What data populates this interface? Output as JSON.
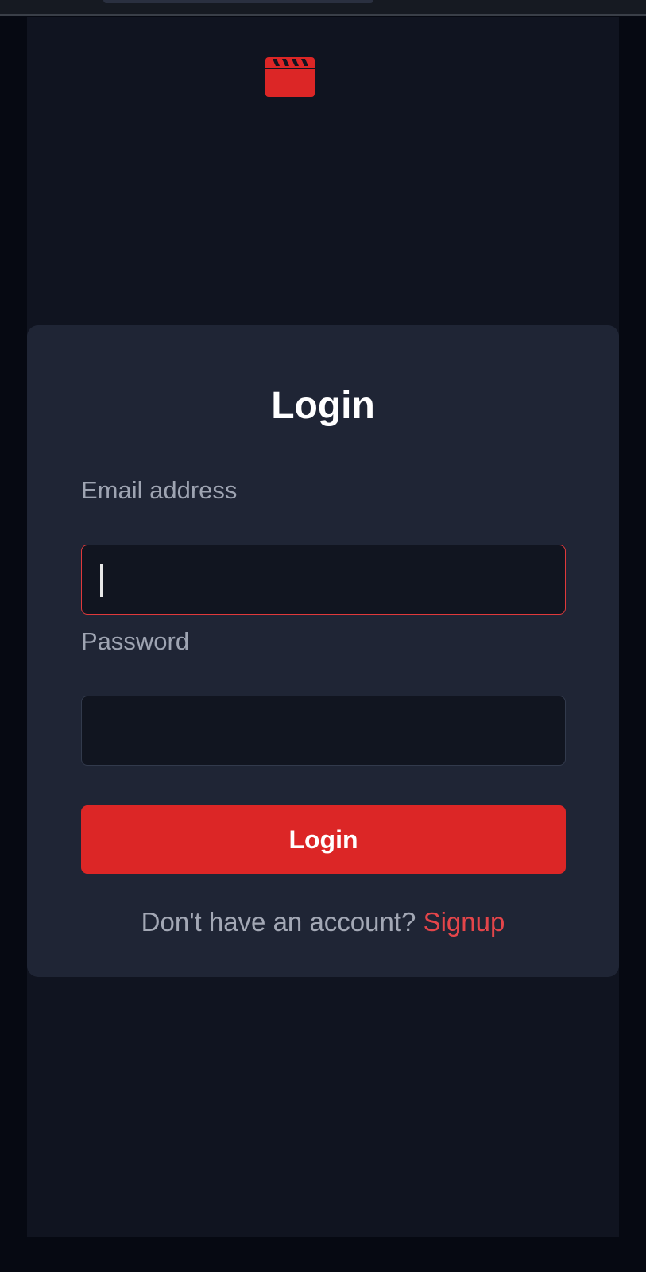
{
  "colors": {
    "accent": "#dc2626",
    "background": "#101420",
    "card": "#1f2535",
    "input_background": "#111520",
    "focus_border": "#e0393b",
    "link": "#e4454a"
  },
  "header": {
    "logo_icon": "film-clapperboard-icon"
  },
  "login_form": {
    "title": "Login",
    "email_label": "Email address",
    "email_value": "",
    "password_label": "Password",
    "password_value": "",
    "submit_label": "Login",
    "signup_prompt": "Don't have an account?",
    "signup_link": "Signup"
  }
}
